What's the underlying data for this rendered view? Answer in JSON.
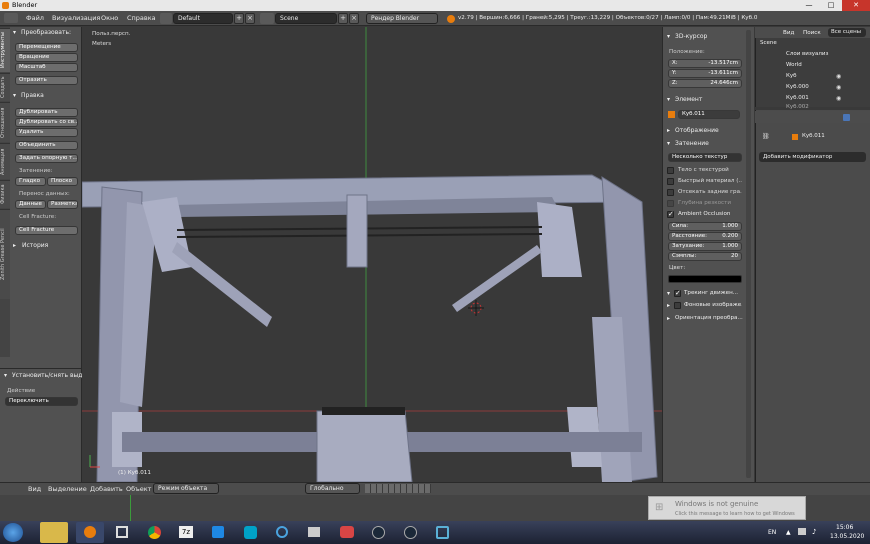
{
  "window": {
    "title": "Blender",
    "controls": [
      "—",
      "□",
      "✕"
    ]
  },
  "menu": {
    "items": [
      "Файл",
      "Визуализация",
      "Окно",
      "Справка"
    ],
    "layout": "Default",
    "scene": "Scene",
    "engine": "Рендер Blender",
    "stats": "v2.79 | Вершин:6,666 | Граней:5,295 | Треуг.:13,229 | Объектов:0/27 | Ламп:0/0 | Пам:49.21MiB | Куб.011"
  },
  "toolshelf": {
    "tabs": [
      "Инструменты",
      "Создать",
      "Отношения",
      "Анимация",
      "Физика",
      "Zenith Grease Pencil"
    ],
    "transform_title": "Преобразовать:",
    "transform_buttons": [
      "Перемещение",
      "Вращение",
      "Масштаб"
    ],
    "mirror": "Отразить",
    "edit_title": "Правка",
    "edit_buttons": [
      "Дублировать",
      "Дублировать со св...",
      "Удалить"
    ],
    "join": "Объединить",
    "set_origin": "Задать опорную т...",
    "shading_label": "Затенение:",
    "smooth": "Гладко",
    "flat": "Плоско",
    "data_transfer_label": "Перенос данных:",
    "data": "Данные",
    "layout_btn": "Разметка",
    "cellfracture_label": "Cell Fracture:",
    "cellfracture_btn": "Cell Fracture",
    "history": "История",
    "operator_title": "Установить/снять выд",
    "action_label": "Действие",
    "action_value": "Переключить"
  },
  "viewport": {
    "view_name": "Польз.персп.",
    "units": "Meters",
    "object_label": "(1) Куб.011"
  },
  "npanel": {
    "cursor_title": "3D-курсор",
    "location_label": "Положение:",
    "x_label": "X:",
    "x": "-13.517cm",
    "y_label": "Y:",
    "y": "-13.611cm",
    "z_label": "Z:",
    "z": "24.646cm",
    "item_title": "Элемент",
    "item_name": "Куб.011",
    "display_title": "Отображение",
    "shading_title": "Затенение",
    "shading_mode": "Несколько текстур",
    "opt_textured_solid": "Тело с текстурой",
    "opt_matcap": "Быстрый материал (...",
    "opt_backface": "Отсекать задние гра...",
    "opt_dof": "Глубина резкости",
    "opt_ao": "Ambient Occlusion",
    "ao_strength_label": "Сила:",
    "ao_strength": "1.000",
    "ao_distance_label": "Расстояние:",
    "ao_distance": "0.200",
    "ao_atten_label": "Затухание:",
    "ao_atten": "1.000",
    "ao_samples_label": "Сэмплы:",
    "ao_samples": "20",
    "color_label": "Цвет:",
    "motion_tracking": "Трекинг движен...",
    "bg_images": "Фоновые изображе...",
    "transform_orient": "Ориентация преобра..."
  },
  "outliner": {
    "tabs": [
      "Вид",
      "Поиск",
      "Все сцены"
    ],
    "rows": [
      "Scene",
      "Слои визуализ",
      "World",
      "Куб",
      "Куб.000",
      "Куб.001",
      "Куб.002"
    ]
  },
  "properties": {
    "object_name": "Куб.011",
    "add_modifier": "Добавить модификатор"
  },
  "bottombar": {
    "items": [
      "Вид",
      "Выделение",
      "Добавить",
      "Объект"
    ],
    "mode": "Режим объекта",
    "orientation": "Глобально"
  },
  "activation": {
    "title": "Windows is not genuine",
    "subtitle": "Click this message to learn how to get Windows"
  },
  "taskbar": {
    "lang": "EN",
    "time": "15:06",
    "date": "13.05.2020"
  },
  "colors": {
    "accent_orange": "#e87d0d",
    "viewport_bg": "#393939",
    "panel_bg": "#515151"
  }
}
